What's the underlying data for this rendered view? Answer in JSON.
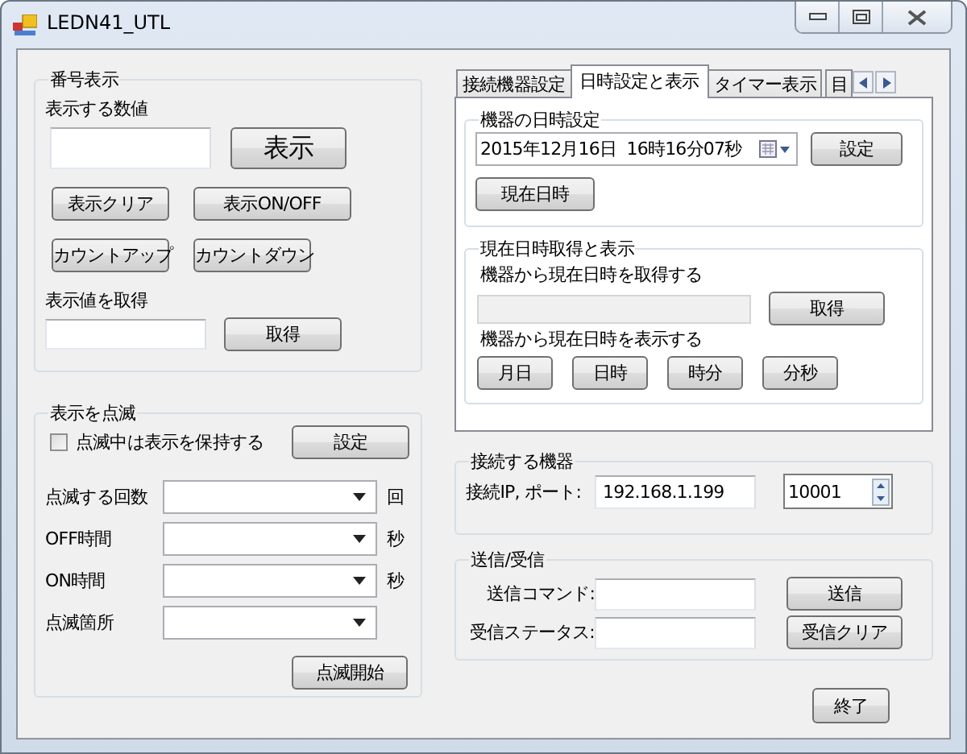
{
  "window": {
    "title": "LEDN41_UTL"
  },
  "number_display": {
    "title": "番号表示",
    "value_label": "表示する数値",
    "show_button": "表示",
    "buttons": [
      "表示クリア",
      "表示ON/OFF",
      "カウントアップ",
      "カウントダウン"
    ],
    "get_label": "表示値を取得",
    "get_button": "取得"
  },
  "blink": {
    "title": "表示を点滅",
    "hold": {
      "label": "点滅中は表示を保持する",
      "checked": false
    },
    "set_button": "設定",
    "fields": [
      {
        "label": "点滅する回数",
        "unit": "回"
      },
      {
        "label": "OFF時間",
        "unit": "秒"
      },
      {
        "label": "ON時間",
        "unit": "秒"
      },
      {
        "label": "点滅箇所"
      }
    ],
    "start_button": "点滅開始"
  },
  "tabs": [
    {
      "label": "接続機器設定",
      "selected": false
    },
    {
      "label": "日時設定と表示",
      "selected": true
    },
    {
      "label": "タイマー表示",
      "selected": false
    },
    {
      "label": "目",
      "selected": false
    }
  ],
  "datetime_set": {
    "title": "機器の日時設定",
    "value": "2015年12月16日  16時16分07秒",
    "set_button": "設定",
    "now_button": "現在日時"
  },
  "datetime_get": {
    "title": "現在日時取得と表示",
    "get_label": "機器から現在日時を取得する",
    "get_field": {
      "disabled": true
    },
    "get_button": "取得",
    "show_label": "機器から現在日時を表示する",
    "show_buttons": [
      "月日",
      "日時",
      "時分",
      "分秒"
    ]
  },
  "connection": {
    "title": "接続する機器",
    "label": "接続IP, ポート:",
    "ip": "192.168.1.199",
    "port": "10001"
  },
  "send_receive": {
    "title": "送信/受信",
    "rows": [
      {
        "label": "送信コマンド:",
        "button": "送信"
      },
      {
        "label": "受信ステータス:",
        "button": "受信クリア"
      }
    ]
  },
  "exit_button": "終了"
}
